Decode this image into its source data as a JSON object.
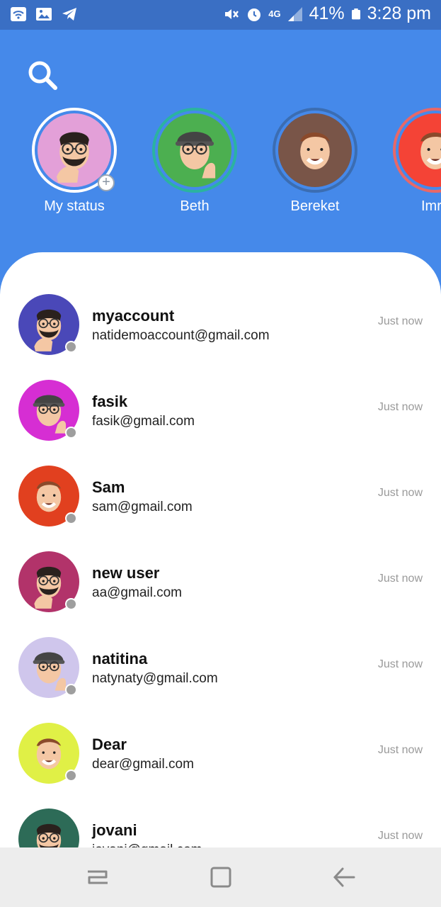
{
  "status_bar": {
    "battery": "41%",
    "time": "3:28 pm",
    "network": "4G",
    "left_icons": [
      "wifi-icon",
      "image-icon",
      "telegram-icon"
    ],
    "right_icons": [
      "mute-icon",
      "alarm-icon",
      "signal-icon",
      "battery-icon"
    ]
  },
  "header": {
    "search_icon": "search-icon"
  },
  "stories": [
    {
      "name": "My status",
      "bg": "#e3a0d8",
      "ring": "#ffffff",
      "kind": "beard"
    },
    {
      "name": "Beth",
      "bg": "#4caf50",
      "ring": "#2bb3a0",
      "kind": "cap"
    },
    {
      "name": "Bereket",
      "bg": "#795548",
      "ring": "#3b6db2",
      "kind": "kid"
    },
    {
      "name": "Imre",
      "bg": "#f44336",
      "ring": "#e86868",
      "kind": "kid"
    }
  ],
  "contacts": [
    {
      "name": "myaccount",
      "email": "natidemoaccount@gmail.com",
      "time": "Just now",
      "bg": "#4a48b8",
      "kind": "beard"
    },
    {
      "name": "fasik",
      "email": "fasik@gmail.com",
      "time": "Just now",
      "bg": "#d62ed3",
      "kind": "cap"
    },
    {
      "name": "Sam",
      "email": "sam@gmail.com",
      "time": "Just now",
      "bg": "#e1401f",
      "kind": "kid"
    },
    {
      "name": "new user",
      "email": "aa@gmail.com",
      "time": "Just now",
      "bg": "#b2336a",
      "kind": "beard"
    },
    {
      "name": "natitina",
      "email": "natynaty@gmail.com",
      "time": "Just now",
      "bg": "#cfc6ec",
      "kind": "cap"
    },
    {
      "name": "Dear",
      "email": "dear@gmail.com",
      "time": "Just now",
      "bg": "#e0f046",
      "kind": "kid"
    },
    {
      "name": "jovani",
      "email": "jovani@gmail.com",
      "time": "Just now",
      "bg": "#2d6b57",
      "kind": "beard"
    }
  ],
  "navbar": {
    "icons": [
      "recent-apps-icon",
      "home-icon",
      "back-icon"
    ]
  },
  "colors": {
    "accent": "#4589ea",
    "status_bar": "#3a6fc4",
    "online_dot": "#9e9e9e"
  }
}
